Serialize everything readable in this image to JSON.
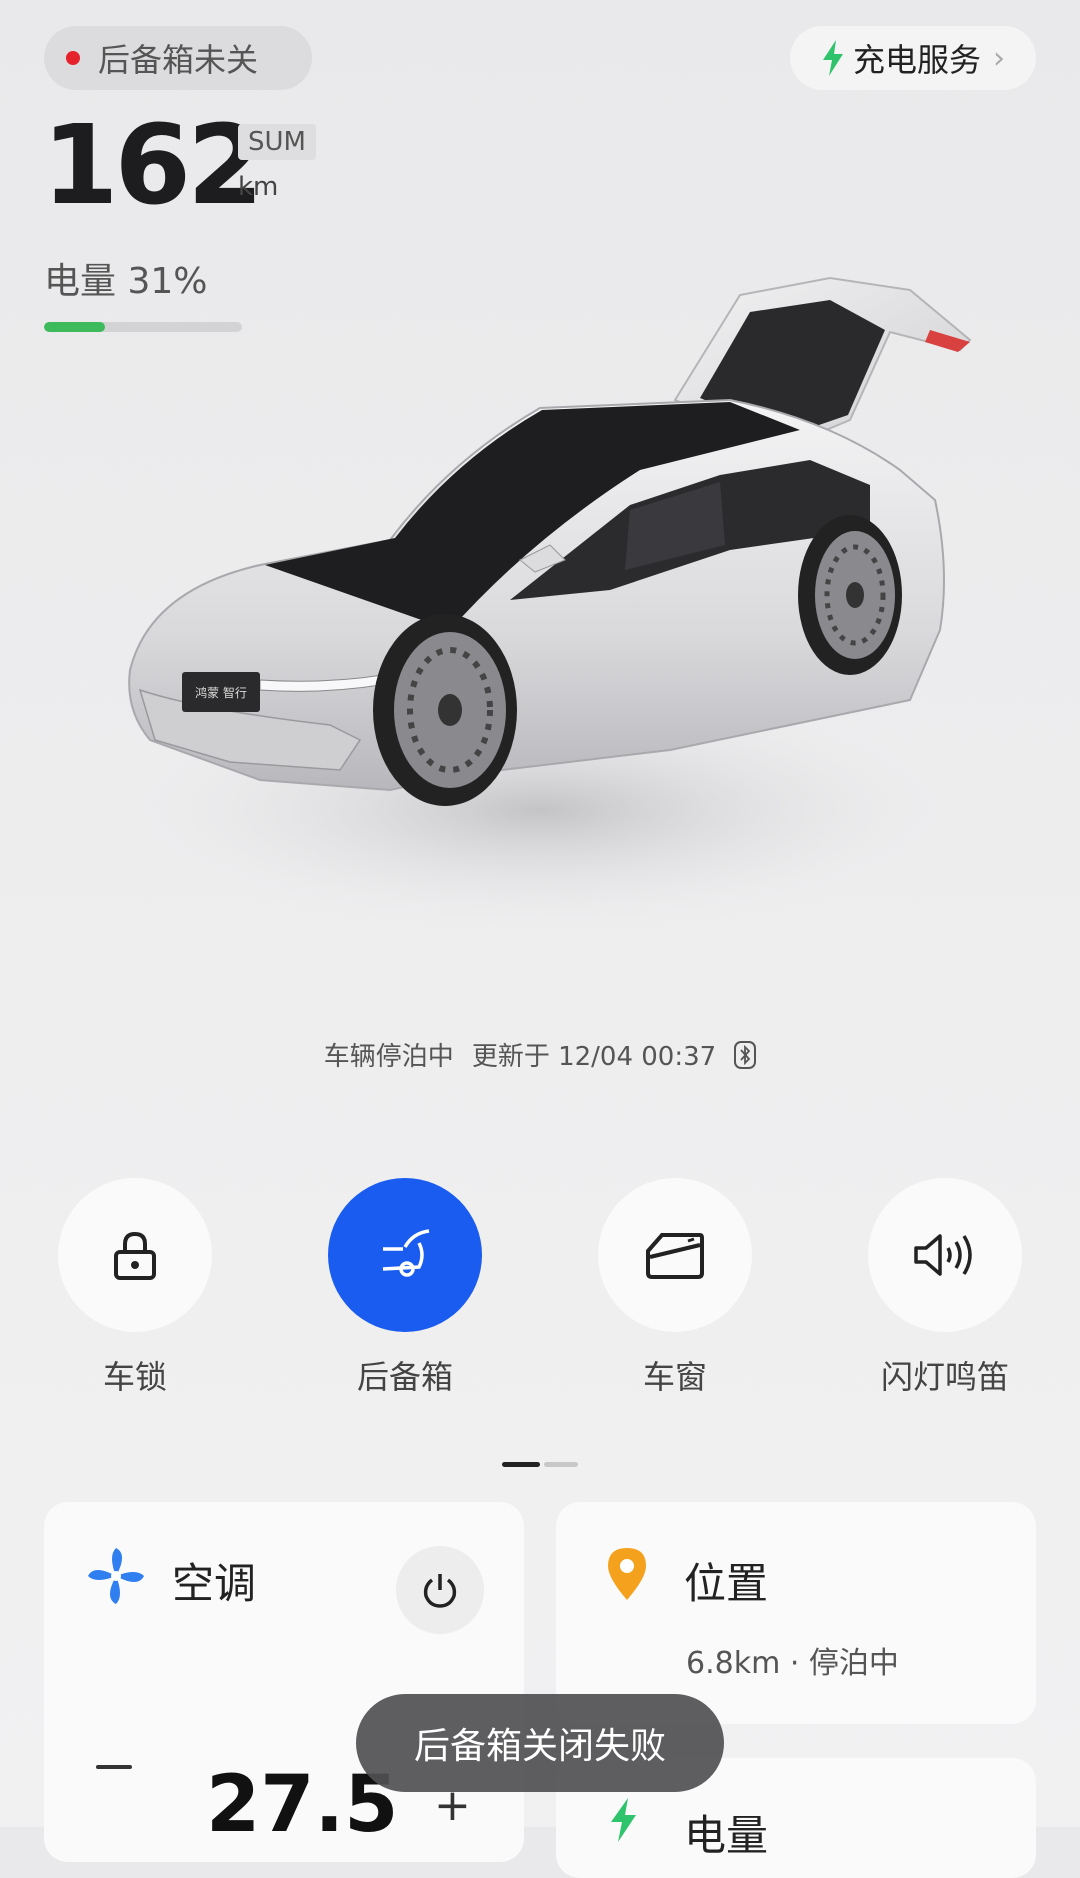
{
  "colors": {
    "accent_blue": "#1a5cf0",
    "status_red": "#e5212b",
    "battery_green": "#3dbb5c",
    "charge_green": "#2fc36b",
    "location_orange": "#f4a21d",
    "fan_blue": "#2f7ff0"
  },
  "header": {
    "status_text": "后备箱未关",
    "charge_label": "充电服务",
    "charge_chevron": "›"
  },
  "range": {
    "value": "162",
    "tag": "SUM",
    "unit": "km"
  },
  "battery": {
    "label": "电量 31%",
    "level_percent": 31
  },
  "vehicle": {
    "parking_status": "车辆停泊中",
    "updated_at": "更新于 12/04 00:37",
    "plate_text": "鸿蒙 智行"
  },
  "controls": [
    {
      "label": "车锁",
      "icon": "lock-icon",
      "active": false
    },
    {
      "label": "后备箱",
      "icon": "trunk-icon",
      "active": true
    },
    {
      "label": "车窗",
      "icon": "window-icon",
      "active": false
    },
    {
      "label": "闪灯鸣笛",
      "icon": "speaker-icon",
      "active": false
    }
  ],
  "cards": {
    "ac": {
      "title": "空调",
      "temperature": "27.5",
      "minus": "—",
      "plus": "+"
    },
    "location": {
      "title": "位置",
      "subtitle": "6.8km · 停泊中"
    },
    "power": {
      "title": "电量"
    }
  },
  "toast": "后备箱关闭失败"
}
